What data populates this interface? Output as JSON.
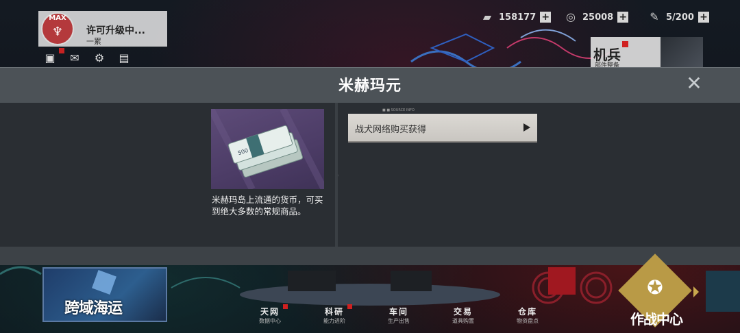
{
  "hud": {
    "profile": {
      "badge": "MAX",
      "title": "许可升级中...",
      "subtitle": "一累"
    },
    "resources": [
      {
        "icon": "card-icon",
        "value": "158177",
        "plus": "+"
      },
      {
        "icon": "medal-icon",
        "value": "25008",
        "plus": "+"
      },
      {
        "icon": "wrench-icon",
        "value": "5/200",
        "plus": "+"
      }
    ],
    "mecha": {
      "label": "机兵",
      "sub": "部件整备"
    }
  },
  "modal": {
    "title": "米赫玛元",
    "close": "✕",
    "item_desc": "米赫玛岛上流通的货币，可买到绝大多数的常规商品。",
    "source_button": "战犬网络购买获得",
    "source_small": "■ ■ SOURCE INFO"
  },
  "bottom": {
    "event_title": "跨域海运",
    "nav": [
      {
        "main": "天网",
        "sub": "数据中心"
      },
      {
        "main": "科研",
        "sub": "能力进阶"
      },
      {
        "main": "车间",
        "sub": "生产出售"
      },
      {
        "main": "交易",
        "sub": "道具购置"
      },
      {
        "main": "仓库",
        "sub": "物资盘点"
      }
    ],
    "combat": "作战中心"
  },
  "colors": {
    "modal_header": "#4c5257",
    "modal_body": "#2a2e33",
    "item_bg": "#5d4b78",
    "accent_gold": "#b99a46",
    "alert_red": "#d02020"
  }
}
